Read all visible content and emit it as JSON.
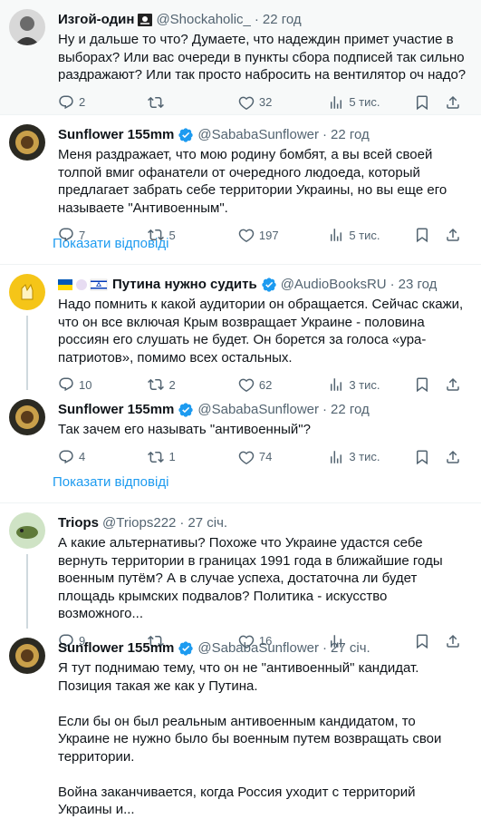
{
  "tweets": [
    {
      "name": "Изгой-один",
      "handle": "@Shockaholic_",
      "time": "22 год",
      "text": "Ну и дальше то что? Думаете, что надеждин примет участие в выборах? Или вас очереди в пункты сбора подписей так сильно раздражают? Или так просто набросить на вентилятор оч надо?",
      "replies": "2",
      "retweets": "",
      "likes": "32",
      "views": "5 тис."
    },
    {
      "name": "Sunflower 155mm",
      "handle": "@SababaSunflower",
      "time": "22 год",
      "text": "Меня раздражает, что мою родину бомбят, а вы всей своей толпой вмиг офанатели от очередного людоеда, который предлагает забрать себе территории Украины, но вы еще его называете \"Антивоенным\".",
      "replies": "7",
      "retweets": "5",
      "likes": "197",
      "views": "5 тис."
    },
    {
      "name": "Путина нужно судить",
      "handle": "@AudioBooksRU",
      "time": "23 год",
      "text": "Надо помнить к какой аудитории он обращается. Сейчас скажи, что он все включая Крым возвращает Украине - половина россиян его слушать не будет. Он борется за голоса «ура-патриотов», помимо всех остальных.",
      "replies": "10",
      "retweets": "2",
      "likes": "62",
      "views": "3 тис."
    },
    {
      "name": "Sunflower 155mm",
      "handle": "@SababaSunflower",
      "time": "22 год",
      "text": "Так зачем его называть \"антивоенный\"?",
      "replies": "4",
      "retweets": "1",
      "likes": "74",
      "views": "3 тис."
    },
    {
      "name": "Triops",
      "handle": "@Triops222",
      "time": "27 січ.",
      "text": "А какие альтернативы? Похоже что Украине удастся себе вернуть территории в границах 1991 года в ближайшие годы военным путём? А в случае успеха, достаточна ли будет площадь крымских подвалов? Политика - искусство возможного...",
      "replies": "9",
      "retweets": "",
      "likes": "16",
      "views": ""
    },
    {
      "name": "Sunflower 155mm",
      "handle": "@SababaSunflower",
      "time": "27 січ.",
      "text": "Я тут поднимаю тему, что он не \"антивоенный\" кандидат. Позиция такая же как у Путина.\n\nЕсли бы он был реальным антивоенным кандидатом, то Украине не нужно было бы военным путем возвращать свои территории.\n\nВойна заканчивается, когда Россия уходит с территорий Украины и..."
    }
  ],
  "show_replies_label": "Показати відповіді",
  "dot": "·",
  "colors": {
    "accent": "#1d9bf0",
    "muted": "#536471",
    "verified": "#1d9bf0"
  }
}
